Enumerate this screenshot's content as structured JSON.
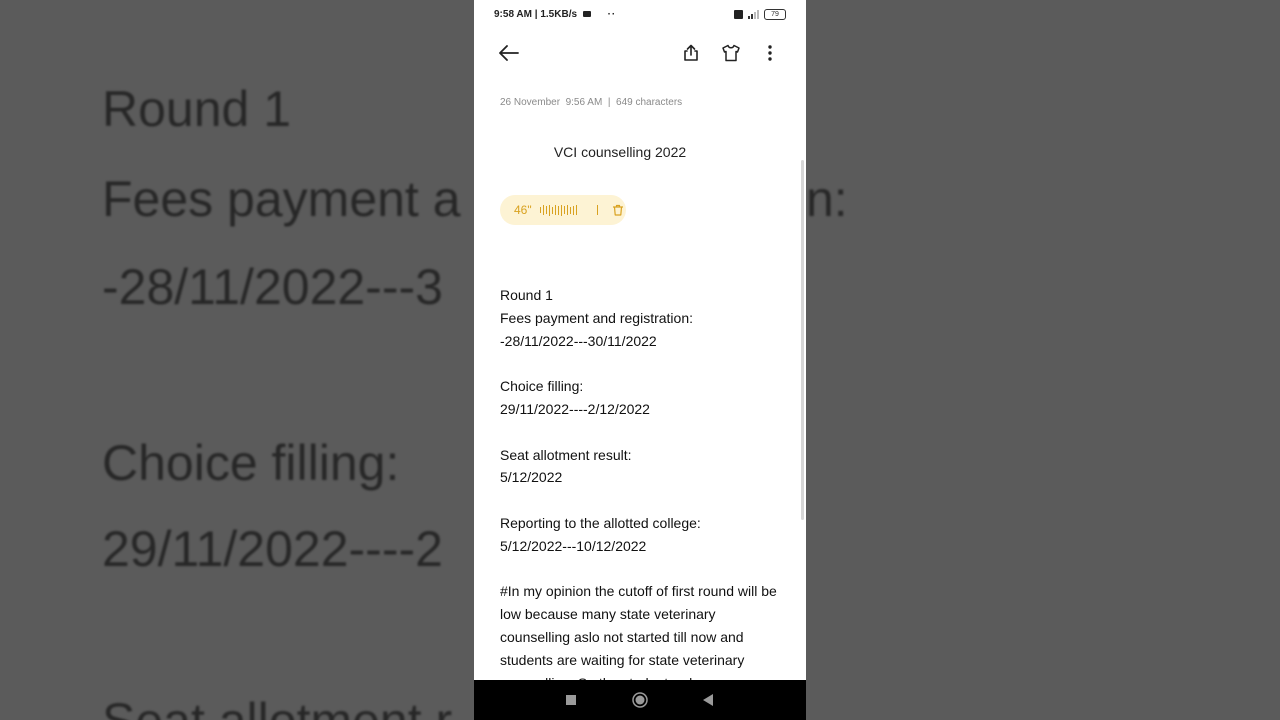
{
  "background": {
    "lines": [
      "Round 1",
      "Fees payment a",
      "n:",
      "-28/11/2022---3",
      "Choice filling:",
      "29/11/2022----2",
      "Seat allotment r"
    ]
  },
  "status_bar": {
    "time": "9:58 AM",
    "speed": "1.5KB/s",
    "more": "··",
    "battery": "79"
  },
  "toolbar": {
    "back_icon": "back-arrow-icon",
    "share_icon": "share-icon",
    "theme_icon": "shirt-icon",
    "more_icon": "more-vertical-icon"
  },
  "note": {
    "date": "26 November",
    "time": "9:56 AM",
    "chars": "649 characters",
    "title": "VCI counselling 2022",
    "audio_duration": "46\"",
    "lines": [
      "Round 1",
      "Fees payment and registration:",
      "-28/11/2022---30/11/2022",
      "",
      "Choice filling:",
      "29/11/2022----2/12/2022",
      "",
      "Seat allotment result:",
      "5/12/2022",
      "",
      "Reporting to the allotted college:",
      "5/12/2022---10/12/2022",
      "",
      "#In my opinion the cutoff of first round will be low because many state veterinary counselling aslo not started till now and students are waiting for state veterinary counselling. So the students who"
    ]
  },
  "colors": {
    "accent": "#d9a220",
    "audio_bg": "#fdf3d4",
    "meta": "#8a8a8a"
  }
}
